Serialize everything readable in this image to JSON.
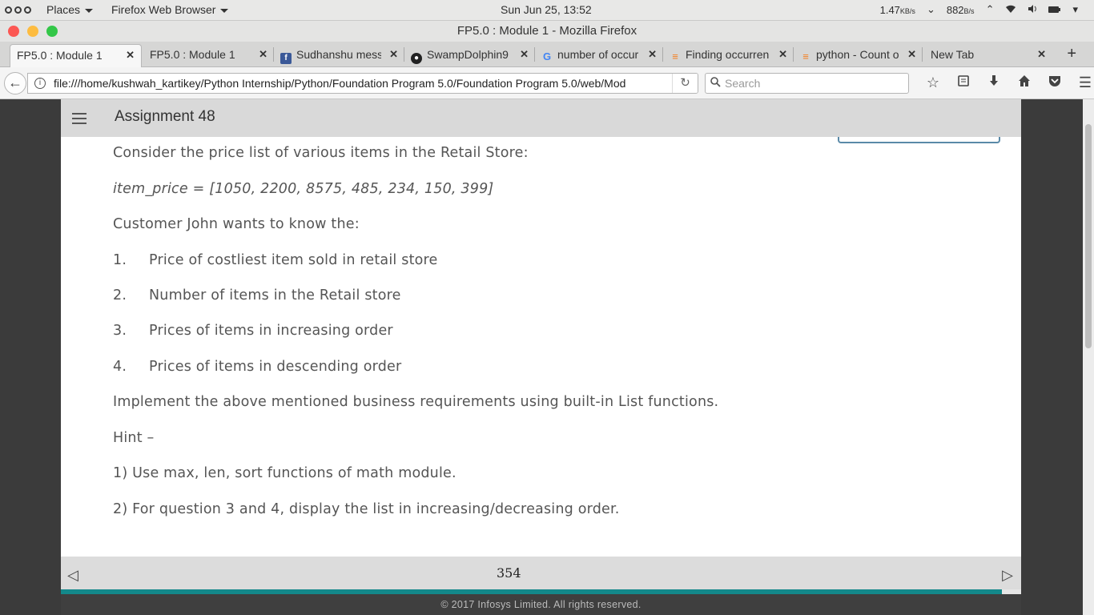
{
  "topbar": {
    "places": "Places",
    "app_menu": "Firefox Web Browser",
    "clock": "Sun Jun 25, 13:52",
    "net_down": "1.47",
    "net_down_unit": "KB/s",
    "net_up": "882",
    "net_up_unit": "B/s"
  },
  "window": {
    "title": "FP5.0 : Module 1 - Mozilla Firefox"
  },
  "tabs": [
    {
      "title": "FP5.0 : Module 1",
      "icon": "none"
    },
    {
      "title": "FP5.0 : Module 1",
      "icon": "none"
    },
    {
      "title": "Sudhanshu mess",
      "icon": "facebook-icon"
    },
    {
      "title": "SwampDolphin9",
      "icon": "github-icon"
    },
    {
      "title": "number of occur",
      "icon": "google-icon"
    },
    {
      "title": "Finding occurren",
      "icon": "stackoverflow-icon"
    },
    {
      "title": "python - Count o",
      "icon": "stackoverflow-icon"
    },
    {
      "title": "New Tab",
      "icon": "none"
    }
  ],
  "nav": {
    "url": "file:///home/kushwah_kartikey/Python Internship/Python/Foundation Program 5.0/Foundation Program 5.0/web/Mod",
    "search_placeholder": "Search"
  },
  "app": {
    "title": "Assignment 48"
  },
  "content": {
    "intro": "Consider the price list of various items in the Retail Store:",
    "code": "item_price = [1050, 2200, 8575, 485, 234, 150, 399]",
    "customer": "Customer John wants to know the:",
    "list": [
      {
        "num": "1.",
        "text": "Price of costliest item sold in retail store"
      },
      {
        "num": "2.",
        "text": "Number of items in the Retail store"
      },
      {
        "num": "3.",
        "text": "Prices of items in increasing order"
      },
      {
        "num": "4.",
        "text": "Prices of items in descending order"
      }
    ],
    "implement": "Implement the above mentioned business requirements using built-in List functions.",
    "hint_label": "Hint –",
    "hint1": "1) Use max, len, sort functions of math module.",
    "hint2": "2) For question 3 and 4, display the list in increasing/decreasing order."
  },
  "footer": {
    "page_number": "354",
    "progress_percent": 98,
    "copyright": "© 2017 Infosys Limited. All rights reserved."
  },
  "colors": {
    "accent": "#13888a",
    "close": "#fc5753",
    "minimize": "#fdbc40",
    "maximize": "#33c748"
  }
}
